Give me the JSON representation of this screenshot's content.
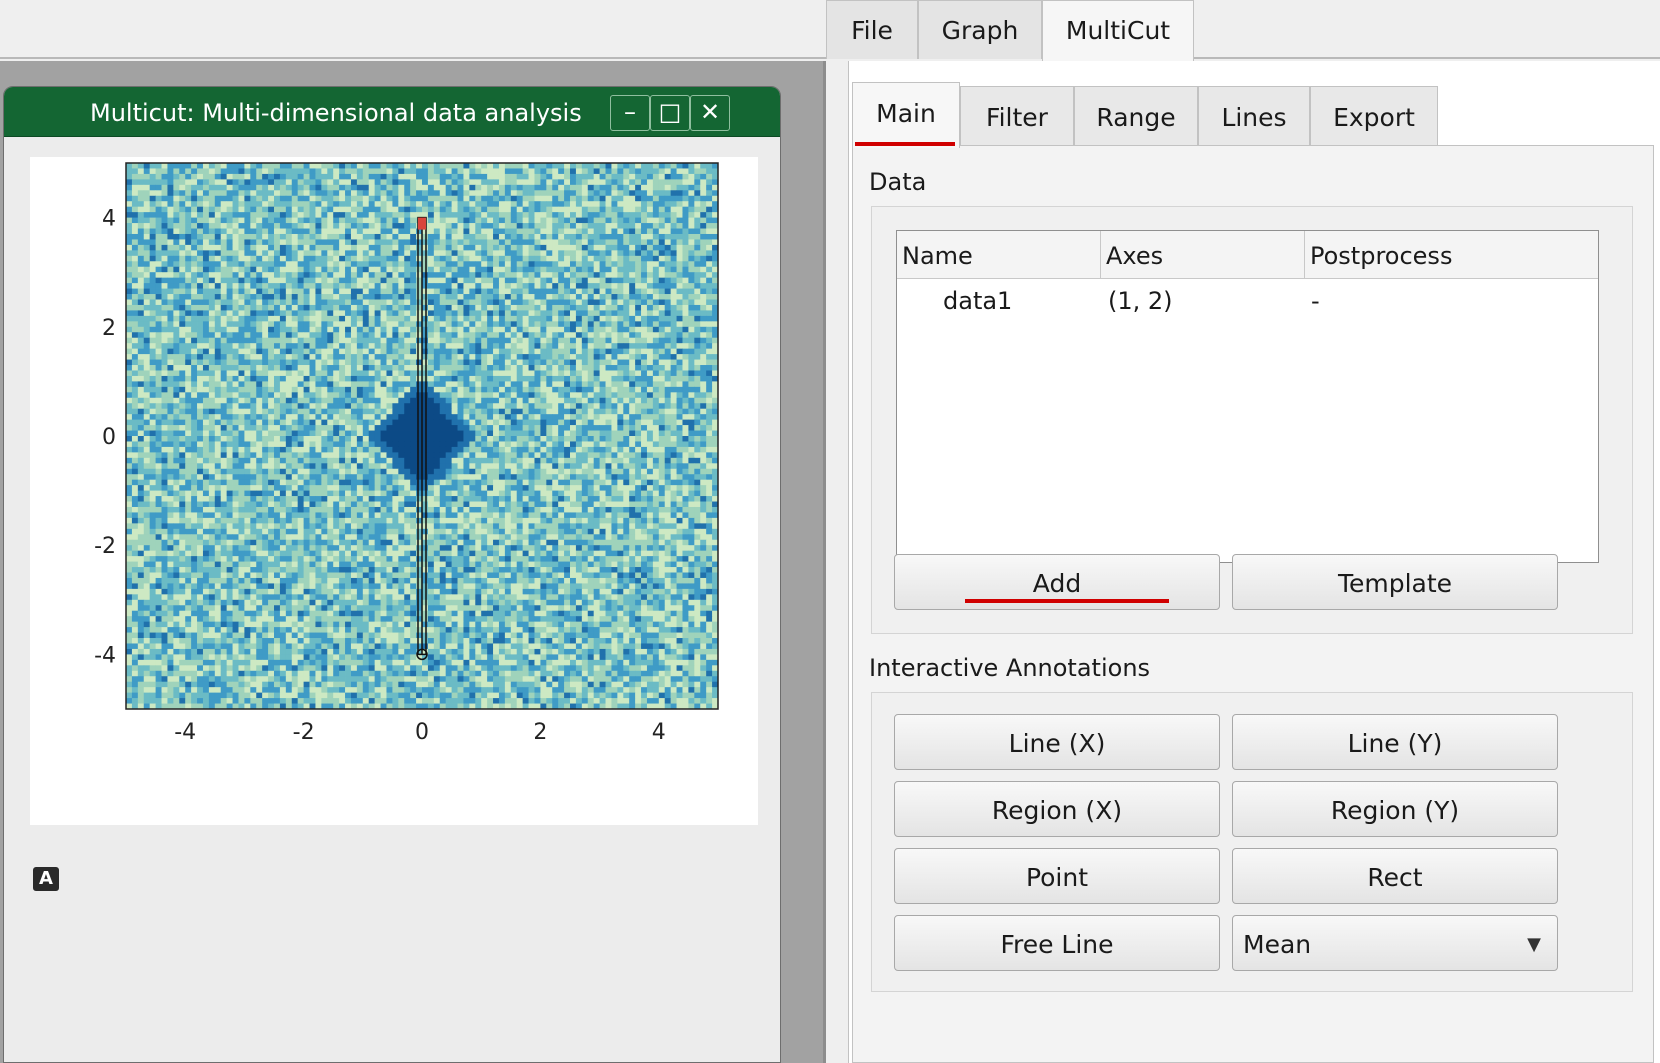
{
  "top_tabs": [
    {
      "label": "File"
    },
    {
      "label": "Graph"
    },
    {
      "label": "MultiCut"
    }
  ],
  "active_top_tab": "MultiCut",
  "subwindow": {
    "title": "Multicut: Multi-dimensional data analysis",
    "minimize_glyph": "–",
    "maximize_glyph": "□",
    "close_glyph": "✕"
  },
  "plot": {
    "auto_button_label": "A",
    "x_ticks": [
      "-4",
      "-2",
      "0",
      "2",
      "4"
    ],
    "y_ticks": [
      "4",
      "2",
      "0",
      "-2",
      "-4"
    ],
    "x_range": [
      -5,
      5
    ],
    "y_range": [
      -5,
      5
    ],
    "colormap": [
      "#f4fae9",
      "#cde9c3",
      "#9fd3bb",
      "#6bbbc5",
      "#3f9bc6",
      "#2071ac",
      "#0c4a86"
    ],
    "line_cut_x": 0,
    "line_cut_y_range": [
      -4,
      4
    ]
  },
  "sub_tabs": [
    {
      "label": "Main"
    },
    {
      "label": "Filter"
    },
    {
      "label": "Range"
    },
    {
      "label": "Lines"
    },
    {
      "label": "Export"
    }
  ],
  "active_sub_tab": "Main",
  "data_group": {
    "title": "Data",
    "columns": [
      "Name",
      "Axes",
      "Postprocess"
    ],
    "rows": [
      {
        "name": "data1",
        "axes": "(1, 2)",
        "postprocess": "-"
      }
    ],
    "add_label": "Add",
    "template_label": "Template"
  },
  "annotations_group": {
    "title": "Interactive Annotations",
    "buttons": [
      "Line (X)",
      "Line (Y)",
      "Region (X)",
      "Region (Y)",
      "Point",
      "Rect",
      "Free Line"
    ],
    "aggregation_value": "Mean"
  },
  "colors": {
    "titlebar": "#146633",
    "highlight_underline": "#d00000"
  }
}
